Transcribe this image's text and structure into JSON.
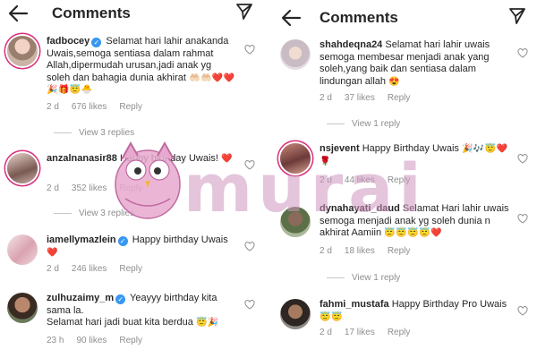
{
  "left": {
    "title": "Comments",
    "comments": [
      {
        "username": "fadbocey",
        "verified": true,
        "text": "Selamat hari lahir anakanda Uwais,semoga sentiasa dalam rahmat Allah,dipermudah urusan,jadi anak yg soleh dan bahagia dunia akhirat",
        "emojis": "🤲🏻🤲🏻❤️❤️🎉🎁😇🐣",
        "time": "2 d",
        "likes": "676 likes",
        "reply": "Reply"
      },
      {
        "username": "anzalnanasir88",
        "verified": false,
        "text": "Happy birthday Uwais!",
        "emojis": "❤️",
        "time": "2 d",
        "likes": "352 likes",
        "reply": "Reply"
      },
      {
        "username": "iamellymazlein",
        "verified": true,
        "text": "Happy birthday Uwais",
        "emojis": "❤️",
        "time": "2 d",
        "likes": "246 likes",
        "reply": "Reply"
      },
      {
        "username": "zulhuzaimy_m",
        "verified": true,
        "text": "Yeayyy birthday kita sama la.",
        "text2": "Selamat hari jadi buat kita berdua",
        "emojis": "😇🎉",
        "time": "23 h",
        "likes": "90 likes",
        "reply": "Reply"
      }
    ],
    "view_replies": [
      "View 3 replies",
      "View 3 replies"
    ]
  },
  "right": {
    "title": "Comments",
    "comments": [
      {
        "username": "shahdeqna24",
        "verified": false,
        "text": "Selamat hari lahir uwais semoga membesar menjadi anak yang soleh,yang baik dan sentiasa dalam lindungan allah",
        "emojis": "😍",
        "time": "2 d",
        "likes": "37 likes",
        "reply": "Reply"
      },
      {
        "username": "nsjevent",
        "verified": false,
        "text": "Happy Birthday Uwais",
        "emojis": "🎉🎶😇❤️🌹",
        "time": "2 d",
        "likes": "44 likes",
        "reply": "Reply"
      },
      {
        "username": "dynahayati_daud",
        "verified": false,
        "text": "Selamat Hari lahir uwais semoga menjadi anak yg soleh dunia n akhirat Aamiin",
        "emojis": "😇😇😇😇❤️",
        "time": "2 d",
        "likes": "18 likes",
        "reply": "Reply"
      },
      {
        "username": "fahmi_mustafa",
        "verified": false,
        "text": "Happy Birthday Pro Uwais",
        "emojis": "😇😇",
        "time": "2 d",
        "likes": "17 likes",
        "reply": "Reply"
      }
    ],
    "view_replies": [
      "View 1 reply",
      "View 1 reply"
    ]
  },
  "watermark": "murai",
  "colors": {
    "verified": "#3897f0",
    "heart": "#e0245e",
    "muted": "#8e8e8e"
  }
}
